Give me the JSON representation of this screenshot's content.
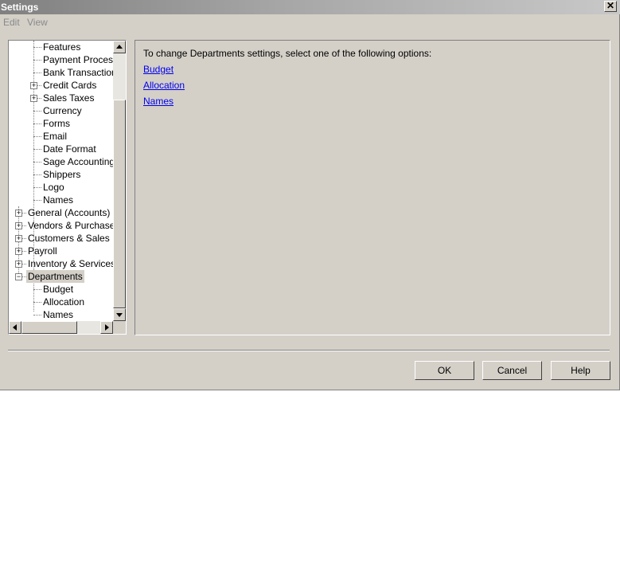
{
  "window": {
    "title": "Settings",
    "close_glyph": "✕"
  },
  "menu": [
    "Edit",
    "View"
  ],
  "tree": {
    "items": [
      {
        "label": "Features",
        "expander": ""
      },
      {
        "label": "Payment Processing",
        "expander": ""
      },
      {
        "label": "Bank Transactions",
        "expander": ""
      },
      {
        "label": "Credit Cards",
        "expander": "+"
      },
      {
        "label": "Sales Taxes",
        "expander": "+"
      },
      {
        "label": "Currency",
        "expander": ""
      },
      {
        "label": "Forms",
        "expander": ""
      },
      {
        "label": "Email",
        "expander": ""
      },
      {
        "label": "Date Format",
        "expander": ""
      },
      {
        "label": "Sage Accounting Integration",
        "expander": ""
      },
      {
        "label": "Shippers",
        "expander": ""
      },
      {
        "label": "Logo",
        "expander": ""
      },
      {
        "label": "Names",
        "expander": ""
      },
      {
        "label": "General (Accounts)",
        "expander": "+"
      },
      {
        "label": "Vendors & Purchases",
        "expander": "+"
      },
      {
        "label": "Customers & Sales",
        "expander": "+"
      },
      {
        "label": "Payroll",
        "expander": "+"
      },
      {
        "label": "Inventory & Services",
        "expander": "+"
      },
      {
        "label": "Departments",
        "expander": "−",
        "selected": true
      },
      {
        "label": "Budget",
        "expander": ""
      },
      {
        "label": "Allocation",
        "expander": ""
      },
      {
        "label": "Names",
        "expander": ""
      }
    ]
  },
  "content": {
    "instruction": "To change Departments settings, select one of the following options:",
    "links": [
      "Budget",
      "Allocation",
      "Names"
    ]
  },
  "buttons": {
    "ok": "OK",
    "cancel": "Cancel",
    "help": "Help"
  }
}
